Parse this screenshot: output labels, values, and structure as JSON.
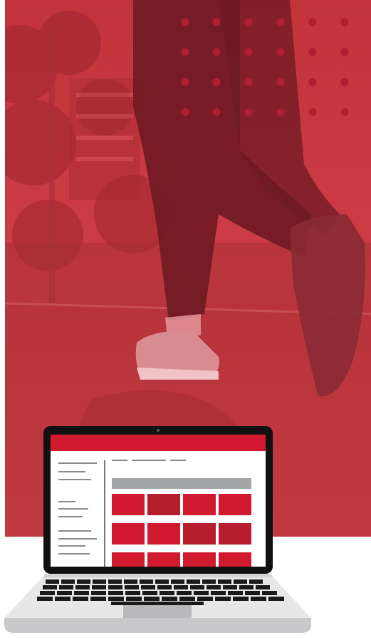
{
  "colors": {
    "hero_red": "#c9363f",
    "dot_red": "#b21d2f",
    "screen_red": "#d11a30",
    "tile_dark_red": "#b81d2e",
    "laptop_black": "#111111",
    "laptop_silver": "#e7e7e8",
    "placeholder_grey": "#a5a6a8"
  },
  "hero": {
    "subject": "runner-legs-photo"
  },
  "laptop": {
    "screen": {
      "tiles": [
        {
          "tone": "red"
        },
        {
          "tone": "dark"
        },
        {
          "tone": "red"
        },
        {
          "tone": "red"
        },
        {
          "tone": "red"
        },
        {
          "tone": "red"
        },
        {
          "tone": "dark"
        },
        {
          "tone": "dark"
        },
        {
          "tone": "red"
        },
        {
          "tone": "red"
        },
        {
          "tone": "red"
        },
        {
          "tone": "red"
        }
      ]
    }
  }
}
